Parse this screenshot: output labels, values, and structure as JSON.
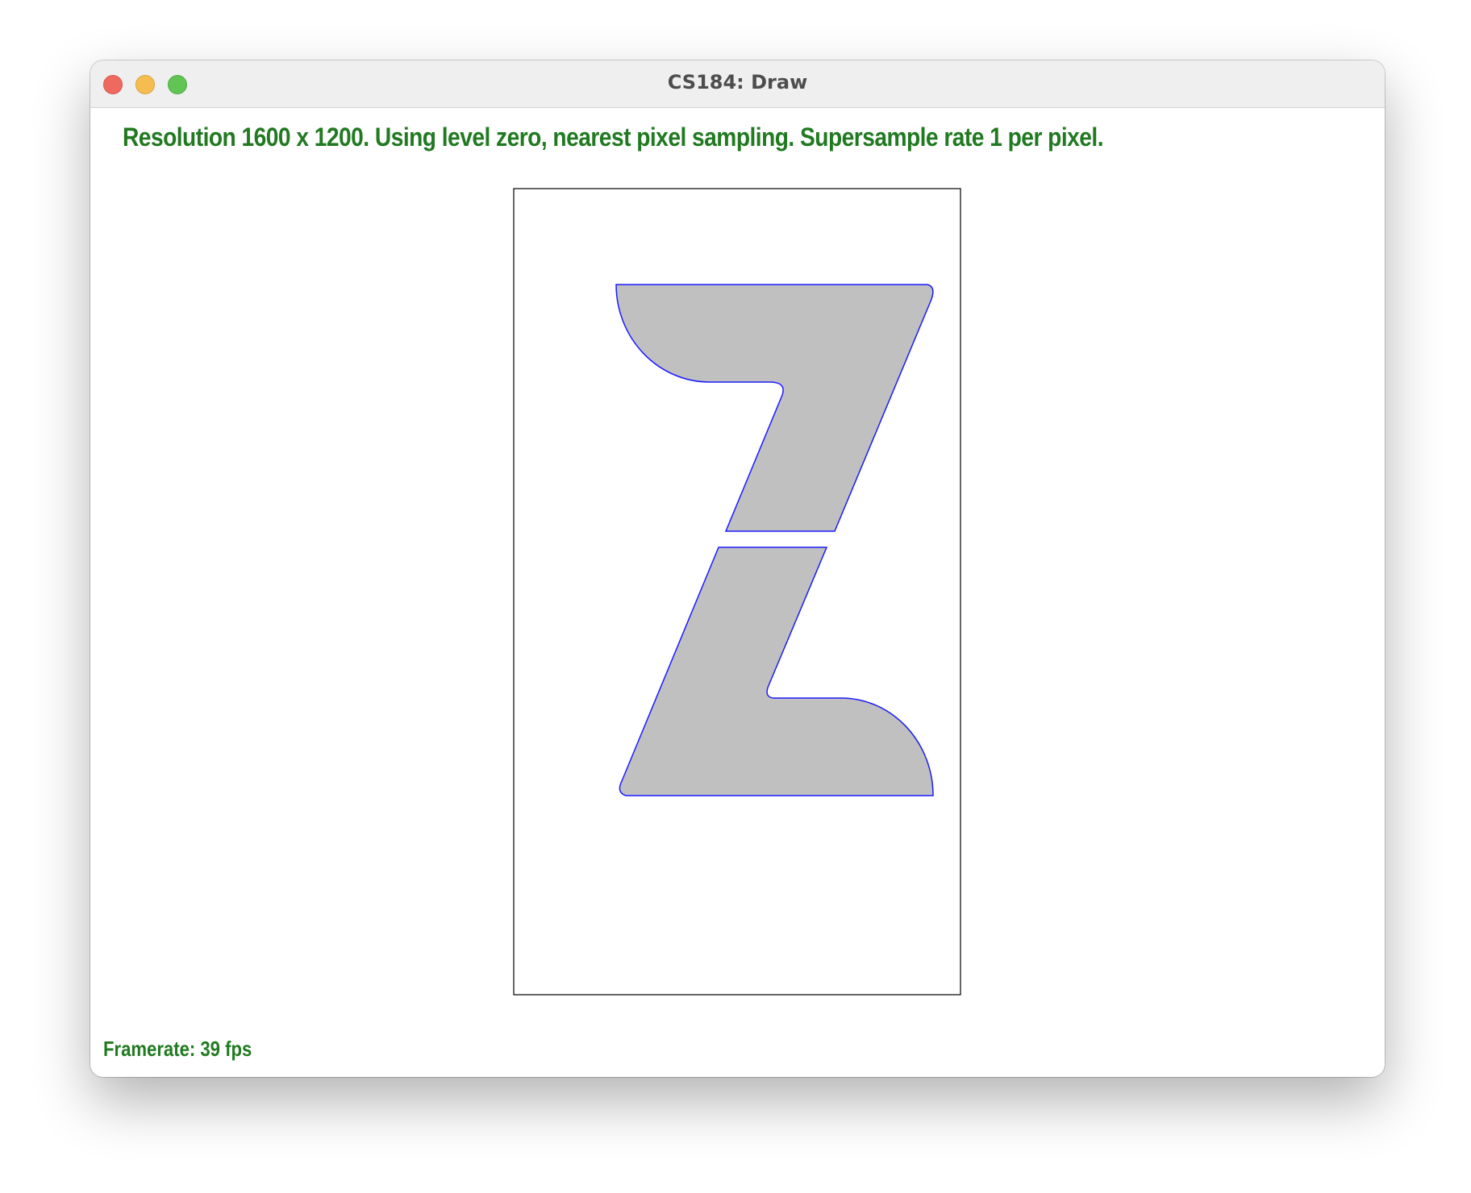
{
  "window": {
    "title": "CS184: Draw"
  },
  "status": {
    "info_line": "Resolution 1600 x 1200. Using level zero, nearest pixel sampling. Supersample rate 1 per pixel.",
    "framerate": "Framerate: 39 fps"
  },
  "colors": {
    "text_green": "#217a21",
    "shape_fill": "#c0c0c0",
    "shape_outline": "#0000ff",
    "frame_border": "#000000"
  }
}
